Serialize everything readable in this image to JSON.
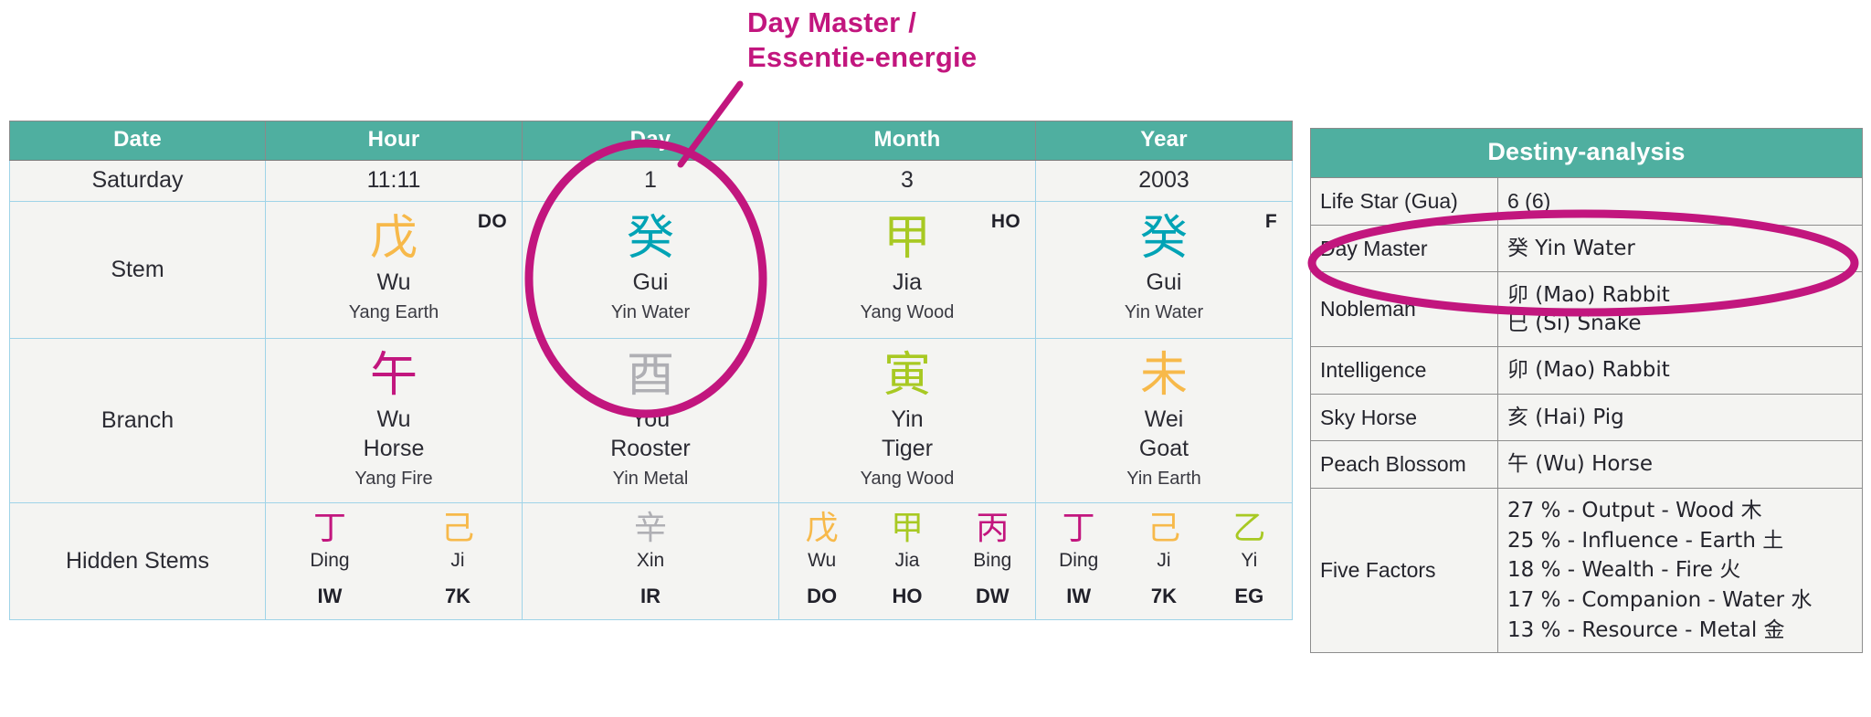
{
  "annotation": {
    "text": "Day Master /\nEssentie-energie",
    "color": "#C2167E"
  },
  "colors": {
    "header_teal": "#4FAFA0",
    "wood": "#A8C923",
    "fire": "#C2167E",
    "earth": "#F7B94A",
    "metal": "#AFAFB4",
    "water": "#00A3B5",
    "annotation": "#C2167E"
  },
  "bazi_table": {
    "headers": [
      "Date",
      "Hour",
      "Day",
      "Month",
      "Year"
    ],
    "date_row": {
      "label": "Saturday",
      "hour": "11:11",
      "day": "1",
      "month": "3",
      "year": "2003"
    },
    "stem_row": {
      "label": "Stem",
      "pillars": [
        {
          "glyph": "戊",
          "pinyin": "Wu",
          "element": "Yang Earth",
          "god": "DO",
          "color": "earth"
        },
        {
          "glyph": "癸",
          "pinyin": "Gui",
          "element": "Yin Water",
          "god": "",
          "color": "water"
        },
        {
          "glyph": "甲",
          "pinyin": "Jia",
          "element": "Yang Wood",
          "god": "HO",
          "color": "wood"
        },
        {
          "glyph": "癸",
          "pinyin": "Gui",
          "element": "Yin Water",
          "god": "F",
          "color": "water"
        }
      ]
    },
    "branch_row": {
      "label": "Branch",
      "pillars": [
        {
          "glyph": "午",
          "pinyin": "Wu",
          "animal": "Horse",
          "element": "Yang Fire",
          "color": "fire"
        },
        {
          "glyph": "酉",
          "pinyin": "You",
          "animal": "Rooster",
          "element": "Yin Metal",
          "color": "metal"
        },
        {
          "glyph": "寅",
          "pinyin": "Yin",
          "animal": "Tiger",
          "element": "Yang Wood",
          "color": "wood"
        },
        {
          "glyph": "未",
          "pinyin": "Wei",
          "animal": "Goat",
          "element": "Yin Earth",
          "color": "earth"
        }
      ]
    },
    "hidden_row": {
      "label": "Hidden Stems",
      "pillars": [
        {
          "items": [
            {
              "glyph": "丁",
              "pinyin": "Ding",
              "code": "IW",
              "color": "fire"
            },
            {
              "glyph": "己",
              "pinyin": "Ji",
              "code": "7K",
              "color": "earth"
            }
          ]
        },
        {
          "items": [
            {
              "glyph": "辛",
              "pinyin": "Xin",
              "code": "IR",
              "color": "metal"
            }
          ]
        },
        {
          "items": [
            {
              "glyph": "戊",
              "pinyin": "Wu",
              "code": "DO",
              "color": "earth"
            },
            {
              "glyph": "甲",
              "pinyin": "Jia",
              "code": "HO",
              "color": "wood"
            },
            {
              "glyph": "丙",
              "pinyin": "Bing",
              "code": "DW",
              "color": "fire"
            }
          ]
        },
        {
          "items": [
            {
              "glyph": "丁",
              "pinyin": "Ding",
              "code": "IW",
              "color": "fire"
            },
            {
              "glyph": "己",
              "pinyin": "Ji",
              "code": "7K",
              "color": "earth"
            },
            {
              "glyph": "乙",
              "pinyin": "Yi",
              "code": "EG",
              "color": "wood"
            }
          ]
        }
      ]
    }
  },
  "destiny": {
    "title": "Destiny-analysis",
    "rows": [
      {
        "key": "Life Star (Gua)",
        "value": "6 (6)"
      },
      {
        "key": "Day Master",
        "value": "癸 Yin Water"
      },
      {
        "key": "Nobleman",
        "value": "卯 (Mao) Rabbit\n巳 (Si) Snake"
      },
      {
        "key": "Intelligence",
        "value": "卯 (Mao) Rabbit"
      },
      {
        "key": "Sky Horse",
        "value": "亥 (Hai) Pig"
      },
      {
        "key": "Peach Blossom",
        "value": "午 (Wu) Horse"
      },
      {
        "key": "Five Factors",
        "value": "27 % - Output - Wood 木\n25 % - Influence - Earth 土\n18 % - Wealth - Fire 火\n17 % - Companion - Water 水\n13 % - Resource - Metal 金"
      }
    ]
  }
}
